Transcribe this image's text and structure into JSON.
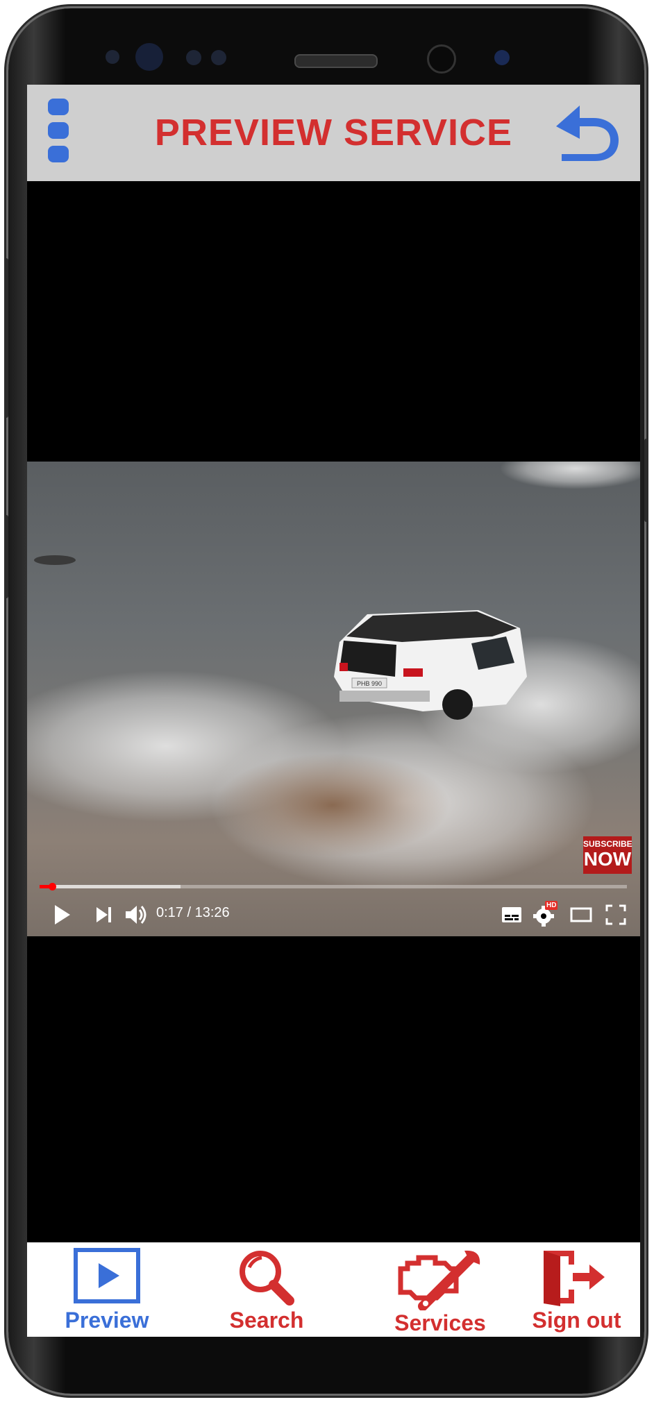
{
  "header": {
    "title": "PREVIEW SERVICE",
    "menu_icon": "kebab-menu-icon",
    "back_icon": "undo-arrow-icon",
    "title_color": "#d32f2f",
    "accent_color": "#3a6fd8"
  },
  "video": {
    "current_time": "0:17",
    "duration": "13:26",
    "time_display": "0:17 / 13:26",
    "played_fraction": 0.021,
    "buffered_fraction": 0.24,
    "overlay": {
      "line1": "SUBSCRIBE",
      "line2": "NOW"
    },
    "plate": "PHB 990",
    "badge_hd": "HD",
    "progress_color": "#ff0000"
  },
  "bottom_nav": {
    "items": [
      {
        "label": "Preview",
        "icon": "play-box-icon",
        "color": "#3a6fd8",
        "active": true
      },
      {
        "label": "Search",
        "icon": "magnifier-icon",
        "color": "#d32f2f",
        "active": false
      },
      {
        "label": "Services",
        "icon": "engine-wrench-icon",
        "color": "#d32f2f",
        "active": false
      },
      {
        "label": "Sign out",
        "icon": "exit-door-icon",
        "color": "#d32f2f",
        "active": false
      }
    ]
  }
}
